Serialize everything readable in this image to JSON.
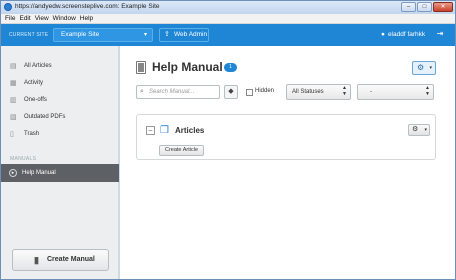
{
  "window": {
    "title": "https://andyedw.screensteplive.com: Example Site",
    "minimize": "–",
    "maximize": "□",
    "close": "✕"
  },
  "menu": [
    "File",
    "Edit",
    "View",
    "Window",
    "Help"
  ],
  "appbar": {
    "current_site_label": "CURRENT SITE",
    "site_name": "Example Site",
    "web_admin": "Web Admin",
    "user_name": "eladdf farhkk"
  },
  "sidebar": {
    "items": [
      {
        "label": "All Articles",
        "icon": "document-icon"
      },
      {
        "label": "Activity",
        "icon": "activity-icon"
      },
      {
        "label": "One-offs",
        "icon": "one-off-icon"
      },
      {
        "label": "Outdated PDFs",
        "icon": "pdf-icon"
      },
      {
        "label": "Trash",
        "icon": "trash-icon"
      }
    ],
    "manuals_header": "MANUALS",
    "selected_manual": "Help Manual",
    "create_manual": "Create Manual"
  },
  "main": {
    "title": "Help Manual",
    "badge": "1",
    "search_placeholder": "Search Manual...",
    "hidden_label": "Hidden",
    "status_select": "All Statuses",
    "second_select": "-",
    "section_title": "Articles",
    "create_article": "Create Article"
  },
  "colors": {
    "accent": "#1f86d5",
    "selected_nav": "#5d6166",
    "sidebar_bg": "#eceeef"
  }
}
